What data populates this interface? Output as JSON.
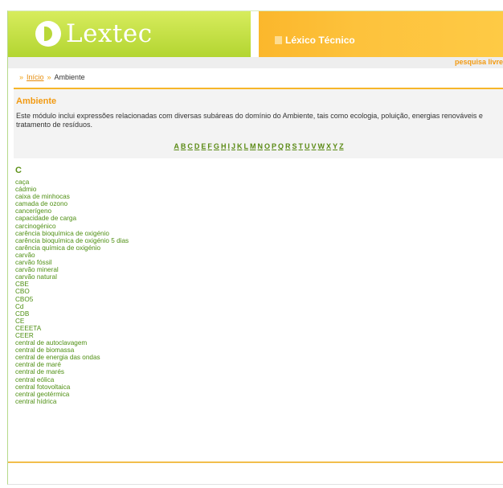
{
  "header": {
    "logo_text": "Lextec",
    "section_title": "Léxico Técnico"
  },
  "search": {
    "link_label": "pesquisa livre"
  },
  "breadcrumb": {
    "home": "Início",
    "current": "Ambiente"
  },
  "module": {
    "title": "Ambiente",
    "description": "Este módulo inclui expressões relacionadas com diversas subáreas do domínio do Ambiente, tais como ecologia, poluição, energias renováveis e tratamento de resíduos."
  },
  "alphabet": [
    "A",
    "B",
    "C",
    "D",
    "E",
    "F",
    "G",
    "H",
    "I",
    "J",
    "K",
    "L",
    "M",
    "N",
    "O",
    "P",
    "Q",
    "R",
    "S",
    "T",
    "U",
    "V",
    "W",
    "X",
    "Y",
    "Z"
  ],
  "current_letter": "C",
  "terms": [
    "caça",
    "cádmio",
    "caixa de minhocas",
    "camada de ozono",
    "cancerígeno",
    "capacidade de carga",
    "carcinogénico",
    "carência bioquímica de oxigénio",
    "carência bioquímica de oxigénio 5 dias",
    "carência química de oxigénio",
    "carvão",
    "carvão fóssil",
    "carvão mineral",
    "carvão natural",
    "CBE",
    "CBO",
    "CBO5",
    "Cd",
    "CDB",
    "CE",
    "CEEETA",
    "CEER",
    "central de autoclavagem",
    "central de biomassa",
    "central de energia das ondas",
    "central de maré",
    "central de marés",
    "central eólica",
    "central fotovoltaica",
    "central geotérmica",
    "central hídrica"
  ],
  "colors": {
    "header_green": "#b9d839",
    "header_orange": "#fdc23c",
    "accent_orange": "#f29a12",
    "link_green": "#4e8f12"
  }
}
